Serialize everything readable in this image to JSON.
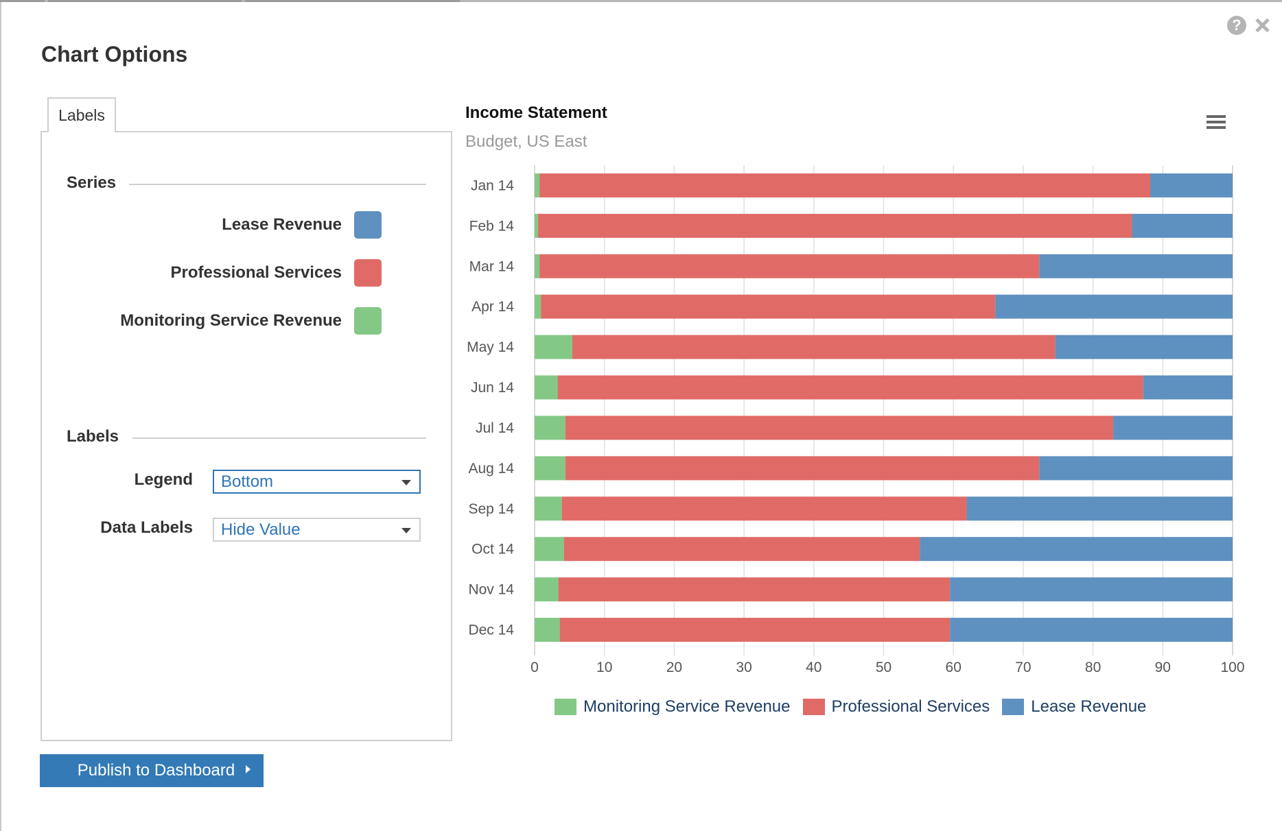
{
  "dialog": {
    "title": "Chart Options",
    "help_icon": "question-circle-icon",
    "close_icon": "close-x-icon"
  },
  "tabs": [
    {
      "label": "Labels",
      "active": true
    }
  ],
  "series_section": {
    "heading": "Series",
    "items": [
      {
        "label": "Lease Revenue",
        "color": "#5e91c0"
      },
      {
        "label": "Professional Services",
        "color": "#e06b66"
      },
      {
        "label": "Monitoring Service Revenue",
        "color": "#83c985"
      }
    ]
  },
  "labels_section": {
    "heading": "Labels",
    "legend": {
      "label": "Legend",
      "value": "Bottom"
    },
    "data_labels": {
      "label": "Data Labels",
      "value": "Hide Value"
    }
  },
  "actions": {
    "publish_label": "Publish to Dashboard",
    "publish_color": "#337ab7"
  },
  "chart_header": {
    "menu_icon": "hamburger-menu-icon"
  },
  "chart_data": {
    "type": "bar",
    "orientation": "horizontal",
    "stacking": "percent",
    "title": "Income Statement",
    "subtitle": "Budget, US East",
    "xlabel": "",
    "ylabel": "",
    "xlim": [
      0,
      100
    ],
    "x_ticks": [
      "0",
      "10",
      "20",
      "30",
      "40",
      "50",
      "60",
      "70",
      "80",
      "90",
      "100"
    ],
    "grid": true,
    "legend_position": "bottom",
    "categories": [
      "Jan 14",
      "Feb 14",
      "Mar 14",
      "Apr 14",
      "May 14",
      "Jun 14",
      "Jul 14",
      "Aug 14",
      "Sep 14",
      "Oct 14",
      "Nov 14",
      "Dec 14"
    ],
    "series": [
      {
        "name": "Monitoring Service Revenue",
        "color": "#83c985",
        "values": [
          0.7,
          0.5,
          0.7,
          0.9,
          5.4,
          3.3,
          4.4,
          4.4,
          3.9,
          4.2,
          3.4,
          3.6
        ]
      },
      {
        "name": "Professional Services",
        "color": "#e06b66",
        "values": [
          87.5,
          85.1,
          71.6,
          65.1,
          69.2,
          83.9,
          78.5,
          67.9,
          58.0,
          51.0,
          56.1,
          55.9
        ]
      },
      {
        "name": "Lease Revenue",
        "color": "#5e91c0",
        "values": [
          11.8,
          14.4,
          27.7,
          34.0,
          25.4,
          12.8,
          17.1,
          27.7,
          38.1,
          44.8,
          40.5,
          40.5
        ]
      }
    ]
  }
}
